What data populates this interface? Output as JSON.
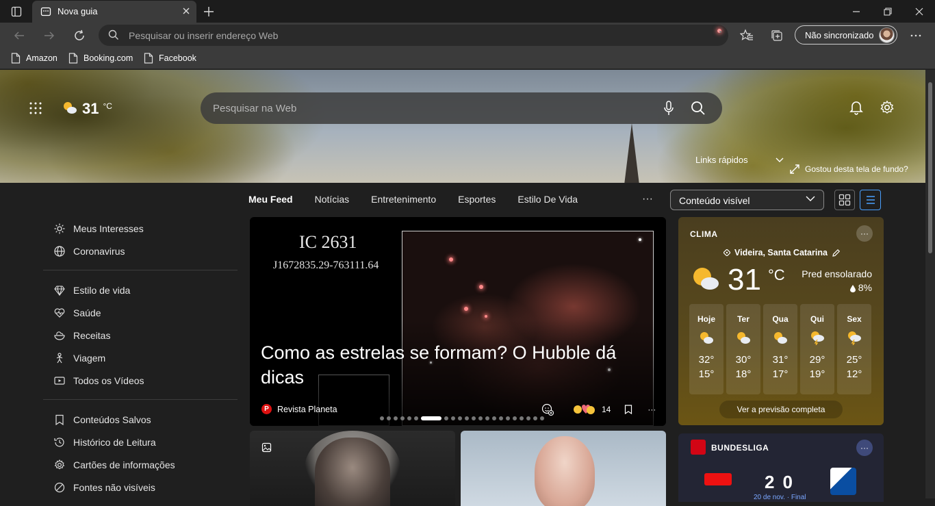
{
  "browser": {
    "tab_title": "Nova guia",
    "address_placeholder": "Pesquisar ou inserir endereço Web",
    "sync_label": "Não sincronizado",
    "bookmarks": [
      "Amazon",
      "Booking.com",
      "Facebook"
    ]
  },
  "hero": {
    "temperature": "31",
    "temp_unit": "°C",
    "search_placeholder": "Pesquisar na Web",
    "quick_links": "Links rápidos",
    "like_background": "Gostou desta tela de fundo?"
  },
  "feed_nav": {
    "tabs": [
      "Meu Feed",
      "Notícias",
      "Entretenimento",
      "Esportes",
      "Estilo De Vida"
    ],
    "more": "···",
    "content_select": "Conteúdo visível"
  },
  "left_menu": {
    "group1": [
      "Meus Interesses",
      "Coronavirus"
    ],
    "group2": [
      "Estilo de vida",
      "Saúde",
      "Receitas",
      "Viagem",
      "Todos os Vídeos"
    ],
    "group3": [
      "Conteúdos Salvos",
      "Histórico de Leitura",
      "Cartões de informações",
      "Fontes não visíveis"
    ]
  },
  "news": {
    "image_caption_1": "IC 2631",
    "image_caption_2": "J1672835.29-763111.64",
    "headline": "Como as estrelas se formam? O Hubble dá dicas",
    "source_initial": "P",
    "source": "Revista Planeta",
    "reaction_count": "14",
    "more": "···",
    "carousel_total": 22,
    "carousel_active": 6
  },
  "weather": {
    "title": "CLIMA",
    "more": "···",
    "location": "Videira, Santa Catarina",
    "temperature": "31",
    "unit": "°C",
    "condition": "Pred ensolarado",
    "precip": "8%",
    "days": [
      {
        "name": "Hoje",
        "hi": "32°",
        "lo": "15°",
        "icon": "partly-sunny"
      },
      {
        "name": "Ter",
        "hi": "30°",
        "lo": "18°",
        "icon": "partly-sunny"
      },
      {
        "name": "Qua",
        "hi": "31°",
        "lo": "17°",
        "icon": "partly-sunny"
      },
      {
        "name": "Qui",
        "hi": "29°",
        "lo": "19°",
        "icon": "thunder"
      },
      {
        "name": "Sex",
        "hi": "25°",
        "lo": "12°",
        "icon": "thunder"
      }
    ],
    "full_forecast": "Ver a previsão completa"
  },
  "bundesliga": {
    "title": "BUNDESLIGA",
    "more": "···",
    "home_score": "2",
    "away_score": "0",
    "date": "20 de nov. · Final"
  },
  "colors": {
    "accent": "#4aa0ff",
    "weather_card": "#5a4a1c",
    "sports_card": "#232534"
  }
}
